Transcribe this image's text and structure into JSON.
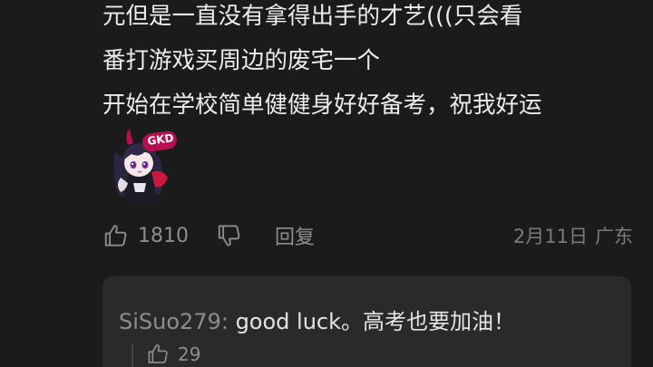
{
  "comment": {
    "lines": [
      "元但是一直没有拿得出手的才艺(((只会看",
      "番打游戏买周边的废宅一个",
      "开始在学校简单健健身好好备考，祝我好运"
    ],
    "sticker": {
      "badge_text": "GKD"
    },
    "actions": {
      "like_count": "1810",
      "reply_label": "回复",
      "date": "2月11日",
      "location": "广东"
    }
  },
  "reply": {
    "username": "SiSuo279:",
    "text": " good luck。高考也要加油！",
    "like_count": "29"
  },
  "icons": {
    "like": "thumbs-up-icon",
    "dislike": "thumbs-down-icon"
  },
  "colors": {
    "background": "#1b1b1b",
    "text_primary": "#ececec",
    "text_secondary": "#8e8e8e",
    "reply_bg": "#2a2a2a",
    "sticker_badge": "#b3114f"
  }
}
